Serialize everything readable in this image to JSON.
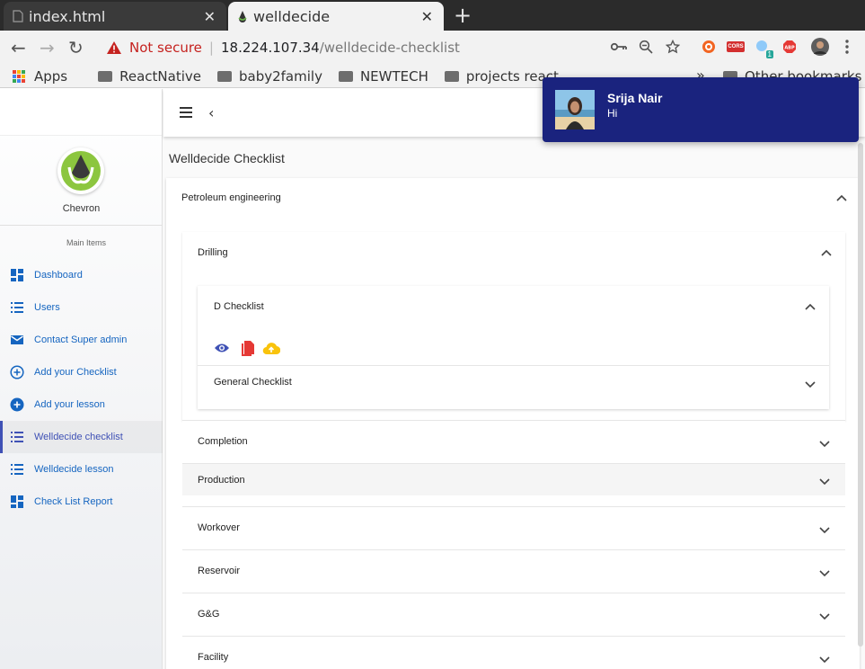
{
  "browser": {
    "tabs": [
      {
        "title": "index.html",
        "close": "✕"
      },
      {
        "title": "welldecide",
        "close": "✕"
      }
    ],
    "new_tab": "+",
    "nav": {
      "back": "←",
      "forward": "→",
      "reload": "↻"
    },
    "address": {
      "not_secure": "Not secure",
      "host": "18.224.107.34",
      "path": "/welldecide-checklist"
    },
    "extensions": {
      "cors_label": "CORS",
      "badge_count": "1",
      "abp_label": "ABP"
    },
    "bookmarks": {
      "apps": "Apps",
      "items": [
        "ReactNative",
        "baby2family",
        "NEWTECH",
        "projects react ..."
      ],
      "more": "»",
      "other": "Other bookmarks"
    }
  },
  "sidebar": {
    "org_name": "Chevron",
    "section_title": "Main Items",
    "items": [
      {
        "label": "Dashboard",
        "icon": "dashboard-icon"
      },
      {
        "label": "Users",
        "icon": "list-icon"
      },
      {
        "label": "Contact Super admin",
        "icon": "mail-icon"
      },
      {
        "label": "Add your Checklist",
        "icon": "add-circle-outline-icon"
      },
      {
        "label": "Add your lesson",
        "icon": "add-circle-icon"
      },
      {
        "label": "Welldecide checklist",
        "icon": "list-icon",
        "active": true
      },
      {
        "label": "Welldecide lesson",
        "icon": "list-icon"
      },
      {
        "label": "Check List Report",
        "icon": "dashboard-icon"
      }
    ]
  },
  "header": {
    "menu_icon": "menu-icon",
    "back_icon": "‹"
  },
  "main": {
    "title": "Welldecide Checklist",
    "category": "Petroleum engineering",
    "subcategory": "Drilling",
    "checklists": [
      "D Checklist",
      "General Checklist"
    ],
    "actions": [
      "view-icon",
      "pdf-icon",
      "cloud-upload-icon"
    ],
    "sections": [
      "Completion",
      "Production",
      "Workover",
      "Reservoir",
      "G&G",
      "Facility"
    ]
  },
  "notification": {
    "name": "Srija Nair",
    "message": "Hi"
  },
  "colors": {
    "primary": "#3f51b5",
    "link": "#1565c0",
    "notification_bg": "#1a237e",
    "pdf_red": "#e53935",
    "cloud_yellow": "#f9c30b"
  }
}
